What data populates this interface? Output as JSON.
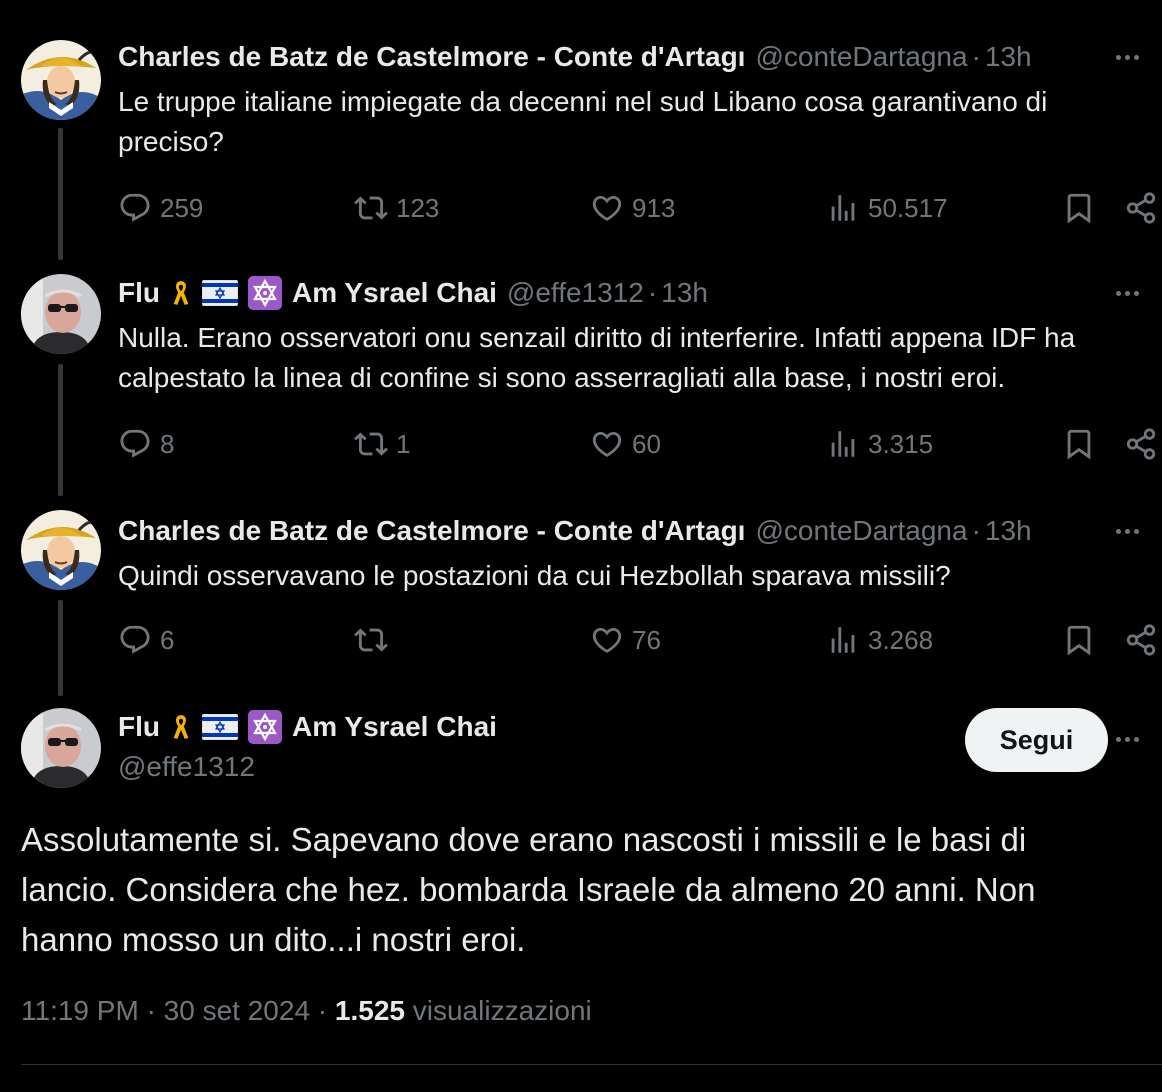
{
  "tweets": [
    {
      "name": "Charles de Batz de Castelmore - Conte d'Artagı",
      "handle": "@conteDartagna",
      "sep": "·",
      "time": "13h",
      "text": "Le truppe italiane impiegate da decenni nel sud Libano cosa garantivano di preciso?",
      "replies": "259",
      "retweets": "123",
      "likes": "913",
      "views": "50.517"
    },
    {
      "name": "Flu",
      "name_suffix": "Am Ysrael Chai",
      "handle": "@effe1312",
      "sep": "·",
      "time": "13h",
      "text": "Nulla. Erano osservatori onu senzail diritto di interferire. Infatti appena IDF ha calpestato la linea di confine si sono asserragliati alla base, i nostri eroi.",
      "replies": "8",
      "retweets": "1",
      "likes": "60",
      "views": "3.315"
    },
    {
      "name": "Charles de Batz de Castelmore - Conte d'Artagı",
      "handle": "@conteDartagna",
      "sep": "·",
      "time": "13h",
      "text": "Quindi osservavano le postazioni da cui Hezbollah sparava missili?",
      "replies": "6",
      "retweets": "",
      "likes": "76",
      "views": "3.268"
    }
  ],
  "main": {
    "name": "Flu",
    "name_suffix": "Am Ysrael Chai",
    "handle": "@effe1312",
    "follow_label": "Segui",
    "text": "Assolutamente si. Sapevano dove erano nascosti i missili e le basi di lancio. Considera che hez. bombarda Israele da almeno 20 anni. Non hanno mosso un dito...i nostri eroi.",
    "time": "11:19 PM",
    "dot": "·",
    "date": "30 set 2024",
    "views": "1.525",
    "views_label": "visualizzazioni"
  },
  "colors": {
    "background": "#000000",
    "text": "#e7e9ea",
    "muted": "#71767b",
    "follow_bg": "#eff3f4"
  }
}
